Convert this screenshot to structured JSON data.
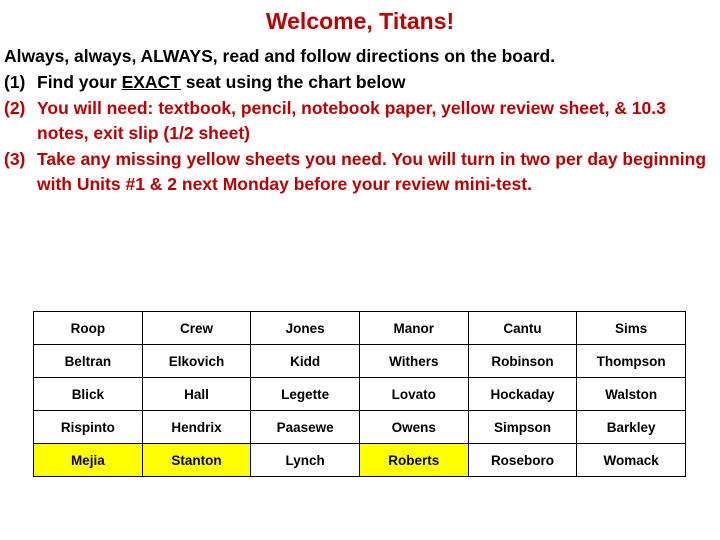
{
  "slide": {
    "title": "Welcome, Titans!",
    "title_color": "#C00000",
    "background_color": "#FFFFFF",
    "intro_line": "Always, always, ALWAYS, read and follow directions on the board.",
    "items": [
      {
        "marker": "(1)",
        "color": "#000000",
        "text_before": "Find your ",
        "text_underlined": "EXACT",
        "text_after": " seat using the chart below"
      },
      {
        "marker": "(2)",
        "color": "#C00000",
        "text": "You will need: textbook, pencil, notebook paper, yellow review sheet, & 10.3 notes, exit slip (1/2 sheet)"
      },
      {
        "marker": "(3)",
        "color": "#C00000",
        "text": "Take any missing yellow sheets you need. You will turn in two per day beginning with Units #1 & 2 next Monday before your review mini-test."
      }
    ]
  },
  "seating_chart": {
    "highlight_color": "#FFFF00",
    "columns": 6,
    "rows_count": 5,
    "rows": [
      [
        {
          "name": "Roop",
          "highlighted": false
        },
        {
          "name": "Crew",
          "highlighted": false
        },
        {
          "name": "Jones",
          "highlighted": false
        },
        {
          "name": "Manor",
          "highlighted": false
        },
        {
          "name": "Cantu",
          "highlighted": false
        },
        {
          "name": "Sims",
          "highlighted": false
        }
      ],
      [
        {
          "name": "Beltran",
          "highlighted": false
        },
        {
          "name": "Elkovich",
          "highlighted": false
        },
        {
          "name": "Kidd",
          "highlighted": false
        },
        {
          "name": "Withers",
          "highlighted": false
        },
        {
          "name": "Robinson",
          "highlighted": false
        },
        {
          "name": "Thompson",
          "highlighted": false
        }
      ],
      [
        {
          "name": "Blick",
          "highlighted": false
        },
        {
          "name": "Hall",
          "highlighted": false
        },
        {
          "name": "Legette",
          "highlighted": false
        },
        {
          "name": "Lovato",
          "highlighted": false
        },
        {
          "name": "Hockaday",
          "highlighted": false
        },
        {
          "name": "Walston",
          "highlighted": false
        }
      ],
      [
        {
          "name": "Rispinto",
          "highlighted": false
        },
        {
          "name": "Hendrix",
          "highlighted": false
        },
        {
          "name": "Paasewe",
          "highlighted": false
        },
        {
          "name": "Owens",
          "highlighted": false
        },
        {
          "name": "Simpson",
          "highlighted": false
        },
        {
          "name": "Barkley",
          "highlighted": false
        }
      ],
      [
        {
          "name": "Mejia",
          "highlighted": true
        },
        {
          "name": "Stanton",
          "highlighted": true
        },
        {
          "name": "Lynch",
          "highlighted": false
        },
        {
          "name": "Roberts",
          "highlighted": true
        },
        {
          "name": "Roseboro",
          "highlighted": false
        },
        {
          "name": "Womack",
          "highlighted": false
        }
      ]
    ]
  }
}
